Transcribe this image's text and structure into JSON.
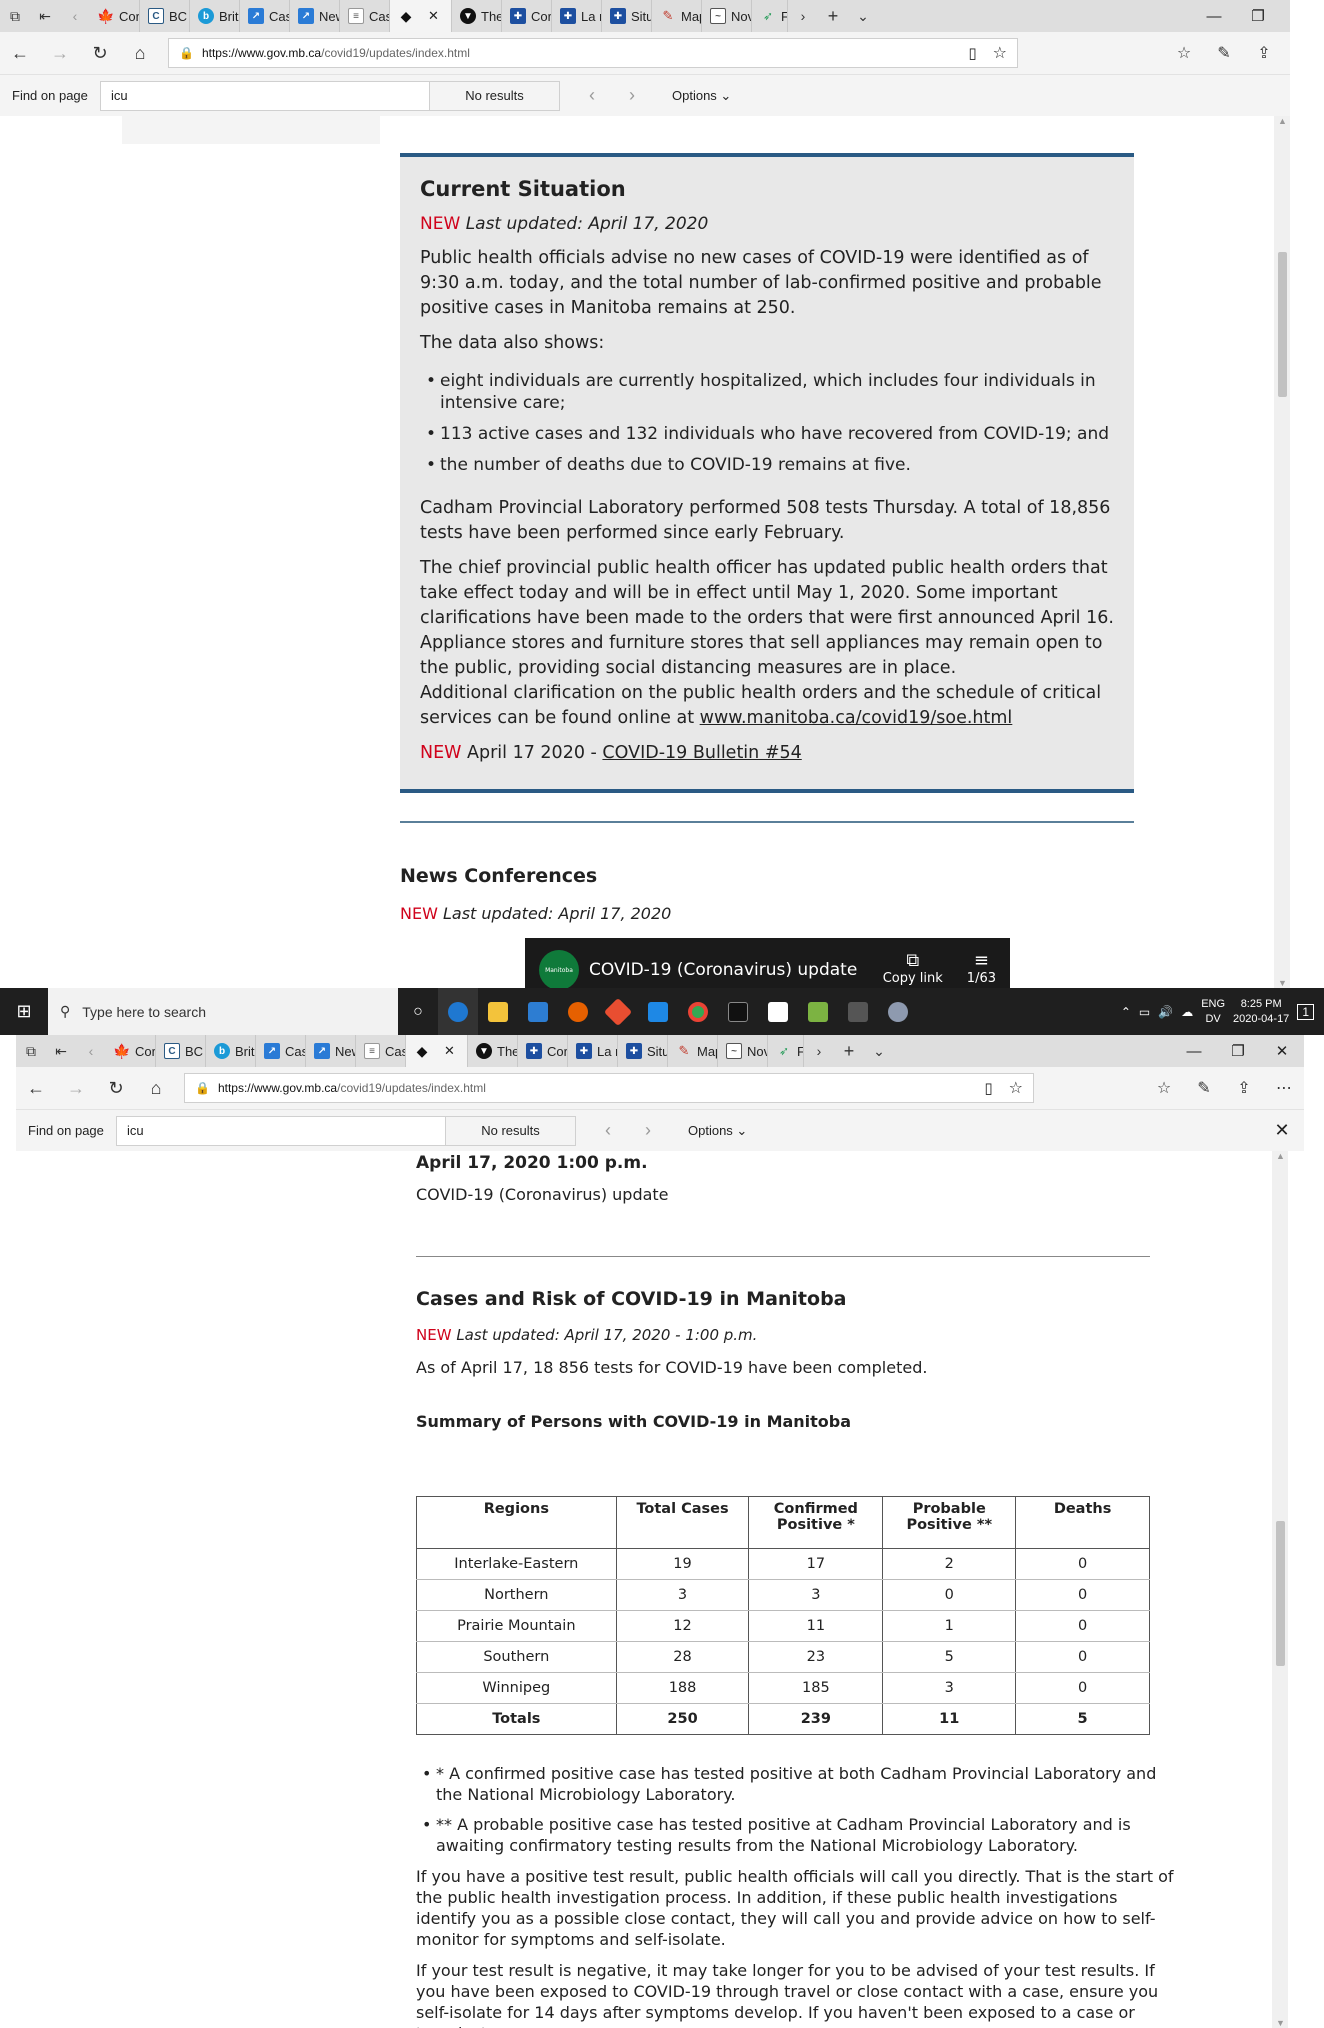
{
  "browser": {
    "tabs": [
      "Coro",
      "BC C",
      "Briti",
      "Case",
      "New",
      "Case",
      "",
      "The",
      "Coro",
      "La n",
      "Situ",
      "Map",
      "Nov",
      "F"
    ],
    "url_host": "https://www.gov.mb.ca",
    "url_path": "/covid19/updates/index.html",
    "find_label": "Find on page",
    "find_query": "icu",
    "find_status": "No results",
    "find_options": "Options"
  },
  "current_situation": {
    "heading": "Current Situation",
    "new_tag": "NEW",
    "last_updated": "Last updated: April 17, 2020",
    "p1": "Public health officials advise no new cases of COVID-19 were identified as of 9:30 a.m. today, and the total number of lab-confirmed positive and probable positive cases in Manitoba remains at 250.",
    "p2": "The data also shows:",
    "bullets": [
      "eight individuals are currently hospitalized, which includes four individuals in intensive care;",
      "113 active cases and 132 individuals who have recovered from COVID-19; and",
      "the number of deaths due to COVID-19 remains at five."
    ],
    "p3": "Cadham Provincial Laboratory performed 508 tests Thursday. A total of 18,856 tests have been performed since early February.",
    "p4": "The chief provincial public health officer has updated public health orders that take effect today and will be in effect until May 1, 2020. Some important clarifications have been made to the orders that were first announced April 16. Appliance stores and furniture stores that sell appliances may remain open to the public, providing social distancing measures are in place.",
    "p5": "Additional clarification on the public health orders and the schedule of critical services can be found online at",
    "p5_link": "www.manitoba.ca/covid19/soe.html",
    "bulletin_new": "NEW",
    "bulletin_text": "April 17 2020 -",
    "bulletin_link": "COVID-19 Bulletin #54"
  },
  "news": {
    "heading": "News Conferences",
    "new_tag": "NEW",
    "last_updated": "Last updated: April 17, 2020",
    "video_logo": "Manitoba",
    "video_title": "COVID-19 (Coronavirus) update",
    "copy_link": "Copy link",
    "counter": "1/63",
    "date_line": "April 17, 2020 1:00 p.m.",
    "caption": "COVID-19 (Coronavirus) update"
  },
  "taskbar": {
    "search_placeholder": "Type here to search",
    "lang": "ENG",
    "lang2": "DV",
    "time": "8:25 PM",
    "date": "2020-04-17",
    "notif": "1"
  },
  "cases": {
    "heading": "Cases and Risk of COVID-19 in Manitoba",
    "new_tag": "NEW",
    "last_updated": "Last updated: April 17, 2020 - 1:00 p.m.",
    "tests_line": "As of April 17, 18 856 tests for COVID-19 have been completed.",
    "summary_heading": "Summary of Persons with COVID-19 in Manitoba",
    "columns": [
      "Regions",
      "Total Cases",
      "Confirmed Positive *",
      "Probable Positive **",
      "Deaths"
    ],
    "rows": [
      [
        "Interlake-Eastern",
        "19",
        "17",
        "2",
        "0"
      ],
      [
        "Northern",
        "3",
        "3",
        "0",
        "0"
      ],
      [
        "Prairie Mountain",
        "12",
        "11",
        "1",
        "0"
      ],
      [
        "Southern",
        "28",
        "23",
        "5",
        "0"
      ],
      [
        "Winnipeg",
        "188",
        "185",
        "3",
        "0"
      ]
    ],
    "totals": [
      "Totals",
      "250",
      "239",
      "11",
      "5"
    ],
    "notes": [
      "* A confirmed positive case has tested positive at both Cadham Provincial Laboratory and the National Microbiology Laboratory.",
      "** A probable positive case has tested positive at Cadham Provincial Laboratory and is awaiting confirmatory testing results from the National Microbiology Laboratory."
    ],
    "para1": "If you have a positive test result, public health officials will call you directly. That is the start of the public health investigation process. In addition, if these public health investigations identify you as a possible close contact, they will call you and provide advice on how to self-monitor for symptoms and self-isolate.",
    "para2": "If your test result is negative, it may take longer for you to be advised of your test results. If you have been exposed to COVID-19 through travel or close contact with a case, ensure you self-isolate for 14 days after symptoms develop. If you haven't been exposed to a case or travel, stay"
  }
}
